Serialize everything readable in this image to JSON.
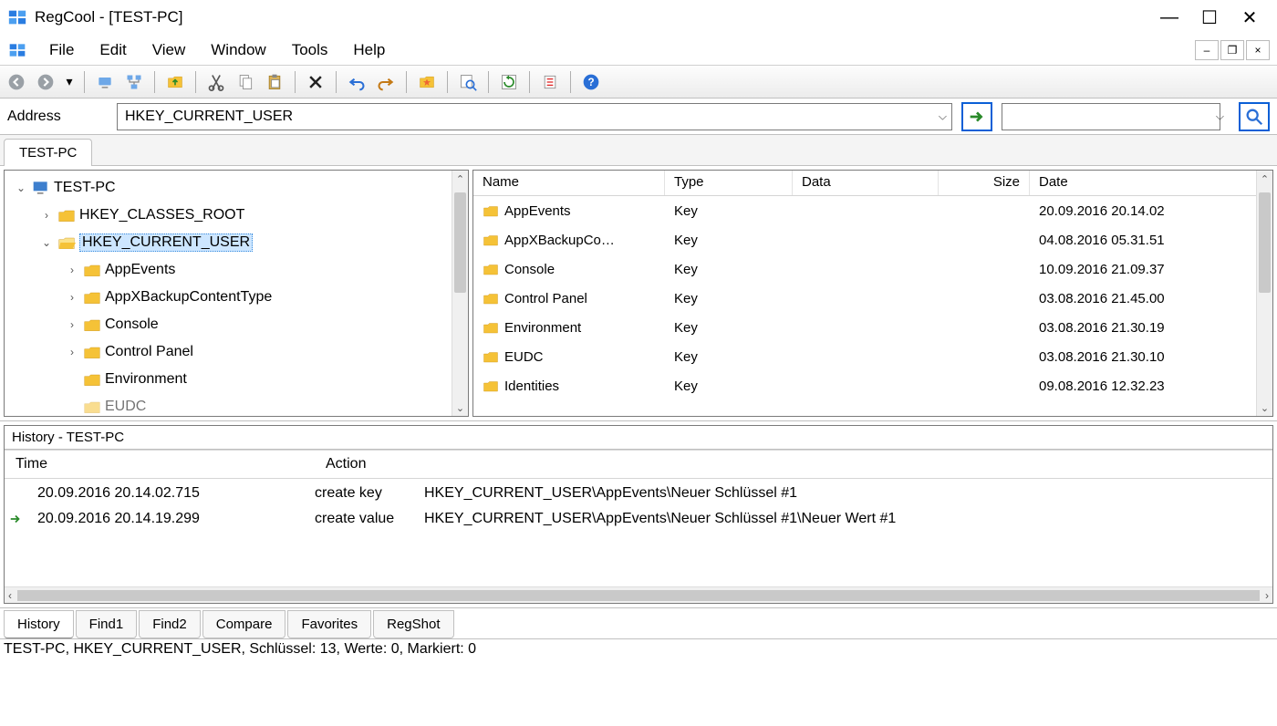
{
  "window": {
    "title": "RegCool - [TEST-PC]"
  },
  "menu": {
    "file": "File",
    "edit": "Edit",
    "view": "View",
    "window": "Window",
    "tools": "Tools",
    "help": "Help"
  },
  "addressbar": {
    "label": "Address",
    "value": "HKEY_CURRENT_USER",
    "search_value": ""
  },
  "top_tab": "TEST-PC",
  "tree": {
    "root": "TEST-PC",
    "n1": "HKEY_CLASSES_ROOT",
    "n2": "HKEY_CURRENT_USER",
    "n2a": "AppEvents",
    "n2b": "AppXBackupContentType",
    "n2c": "Console",
    "n2d": "Control Panel",
    "n2e": "Environment",
    "n2f": "EUDC"
  },
  "list": {
    "headers": {
      "name": "Name",
      "type": "Type",
      "data": "Data",
      "size": "Size",
      "date": "Date"
    },
    "rows": [
      {
        "name": "AppEvents",
        "type": "Key",
        "data": "",
        "size": "",
        "date": "20.09.2016 20.14.02"
      },
      {
        "name": "AppXBackupCo…",
        "type": "Key",
        "data": "",
        "size": "",
        "date": "04.08.2016 05.31.51"
      },
      {
        "name": "Console",
        "type": "Key",
        "data": "",
        "size": "",
        "date": "10.09.2016 21.09.37"
      },
      {
        "name": "Control Panel",
        "type": "Key",
        "data": "",
        "size": "",
        "date": "03.08.2016 21.45.00"
      },
      {
        "name": "Environment",
        "type": "Key",
        "data": "",
        "size": "",
        "date": "03.08.2016 21.30.19"
      },
      {
        "name": "EUDC",
        "type": "Key",
        "data": "",
        "size": "",
        "date": "03.08.2016 21.30.10"
      },
      {
        "name": "Identities",
        "type": "Key",
        "data": "",
        "size": "",
        "date": "09.08.2016 12.32.23"
      }
    ]
  },
  "history": {
    "title": "History - TEST-PC",
    "headers": {
      "time": "Time",
      "action": "Action"
    },
    "rows": [
      {
        "time": "20.09.2016 20.14.02.715",
        "action": "create key",
        "detail": "HKEY_CURRENT_USER\\AppEvents\\Neuer Schlüssel #1",
        "current": false
      },
      {
        "time": "20.09.2016 20.14.19.299",
        "action": "create value",
        "detail": "HKEY_CURRENT_USER\\AppEvents\\Neuer Schlüssel #1\\Neuer Wert #1",
        "current": true
      }
    ]
  },
  "bottom_tabs": {
    "history": "History",
    "find1": "Find1",
    "find2": "Find2",
    "compare": "Compare",
    "favorites": "Favorites",
    "regshot": "RegShot"
  },
  "statusbar": "TEST-PC, HKEY_CURRENT_USER, Schlüssel: 13, Werte: 0, Markiert: 0"
}
